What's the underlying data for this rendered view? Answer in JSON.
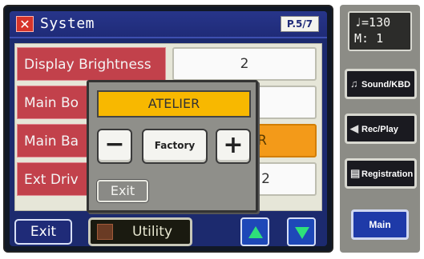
{
  "window": {
    "title": "System",
    "page": "P.5/7",
    "close_icon_glyph": "✕"
  },
  "rows": [
    {
      "label": "Display Brightness",
      "value": "2",
      "selected": false
    },
    {
      "label": "Main Bo",
      "value": "",
      "selected": false
    },
    {
      "label": "Main Ba",
      "value": "IER",
      "selected": true
    },
    {
      "label": "Ext Driv",
      "value": "2",
      "selected": false
    }
  ],
  "popup": {
    "name": "ATELIER",
    "minus": "−",
    "factory": "Factory",
    "plus": "+",
    "exit": "Exit"
  },
  "bottom": {
    "exit": "Exit",
    "utility": "Utility"
  },
  "side": {
    "display_line1": "♩=130",
    "display_line2": "M:  1",
    "sound_kbd": "Sound/KBD",
    "rec_play": "Rec/Play",
    "registration": "Registration",
    "main": "Main"
  },
  "colors": {
    "accent_orange": "#f39a19",
    "popup_yellow": "#f8b800",
    "row_red": "#c2414b",
    "frame_blue": "#1c2a6e",
    "arrow_green": "#2ee07a"
  }
}
